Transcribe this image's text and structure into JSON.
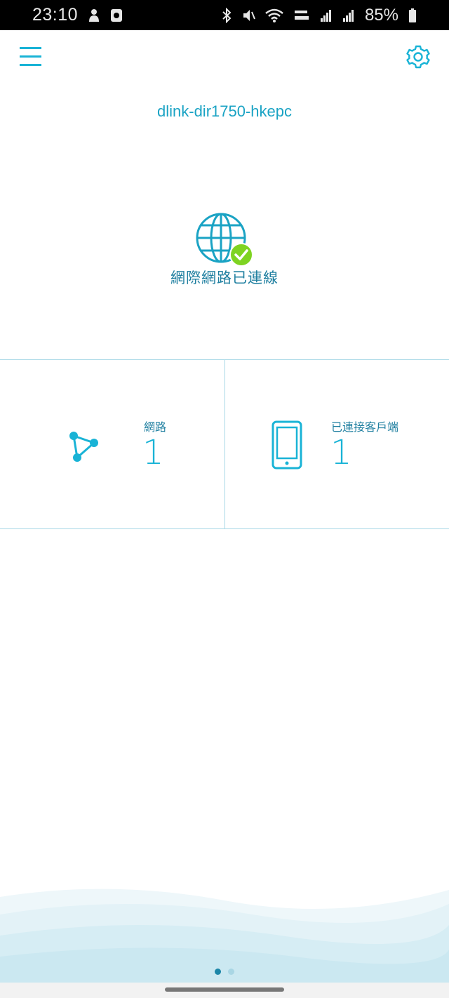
{
  "status_bar": {
    "time": "23:10",
    "battery": "85%",
    "icons": [
      "user-icon",
      "notification-icon",
      "bluetooth-icon",
      "mute-icon",
      "wifi-icon",
      "volte-icon",
      "signal-icon",
      "signal-roaming-icon",
      "battery-icon"
    ]
  },
  "header": {
    "menu_icon": "hamburger-menu-icon",
    "settings_icon": "gear-icon"
  },
  "device": {
    "name": "dlink-dir1750-hkepc"
  },
  "internet": {
    "status": "網際網路已連線",
    "icon": "globe-icon",
    "badge_icon": "check-icon"
  },
  "stats": {
    "network": {
      "label": "網路",
      "value": "1",
      "icon": "network-topology-icon"
    },
    "clients": {
      "label": "已連接客戶端",
      "value": "1",
      "icon": "phone-icon"
    }
  },
  "pager": {
    "pages": 2,
    "active": 1
  },
  "colors": {
    "accent": "#19b3d6",
    "text": "#1f7fa0",
    "check": "#7ed321",
    "divider": "#a8d8e6"
  }
}
